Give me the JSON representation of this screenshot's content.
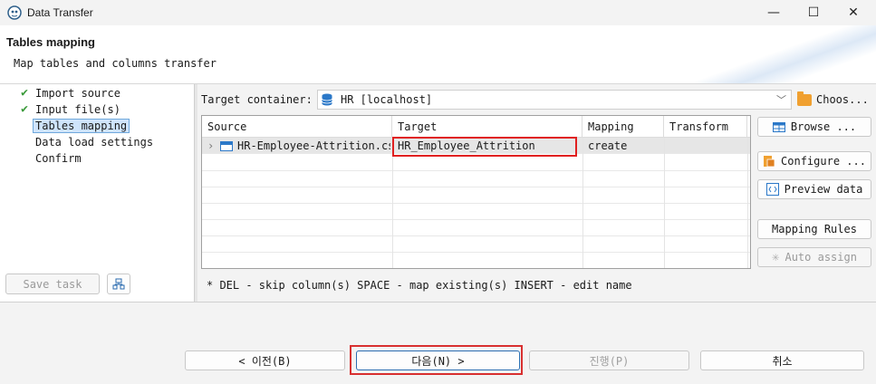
{
  "window": {
    "title": "Data Transfer",
    "minimize": "—",
    "maximize": "☐",
    "close": "✕"
  },
  "header": {
    "title": "Tables mapping",
    "subtitle": "Map tables and columns transfer"
  },
  "steps": [
    {
      "label": "Import source",
      "done": true
    },
    {
      "label": "Input file(s)",
      "done": true
    },
    {
      "label": "Tables mapping",
      "selected": true
    },
    {
      "label": "Data load settings"
    },
    {
      "label": "Confirm"
    }
  ],
  "left_buttons": {
    "save_task": "Save task"
  },
  "target": {
    "label": "Target container:",
    "value": "HR  [localhost]",
    "choose": "Choos..."
  },
  "table": {
    "columns": [
      "Source",
      "Target",
      "Mapping",
      "Transform"
    ],
    "rows": [
      {
        "source": "HR-Employee-Attrition.csv",
        "target": "HR_Employee_Attrition",
        "mapping": "create",
        "transform": ""
      }
    ]
  },
  "hint": "* DEL - skip column(s)  SPACE - map existing(s)  INSERT - edit name",
  "right_buttons": {
    "browse": "Browse ...",
    "configure": "Configure ...",
    "preview": "Preview data",
    "mapping_rules": "Mapping Rules",
    "auto_assign": "Auto assign"
  },
  "footer": {
    "back": "< 이전(B)",
    "next": "다음(N) >",
    "proceed": "진행(P)",
    "cancel": "취소"
  },
  "colors": {
    "check": "#3a9a3a",
    "highlight": "#e02020",
    "selection": "#cfe4fb"
  }
}
